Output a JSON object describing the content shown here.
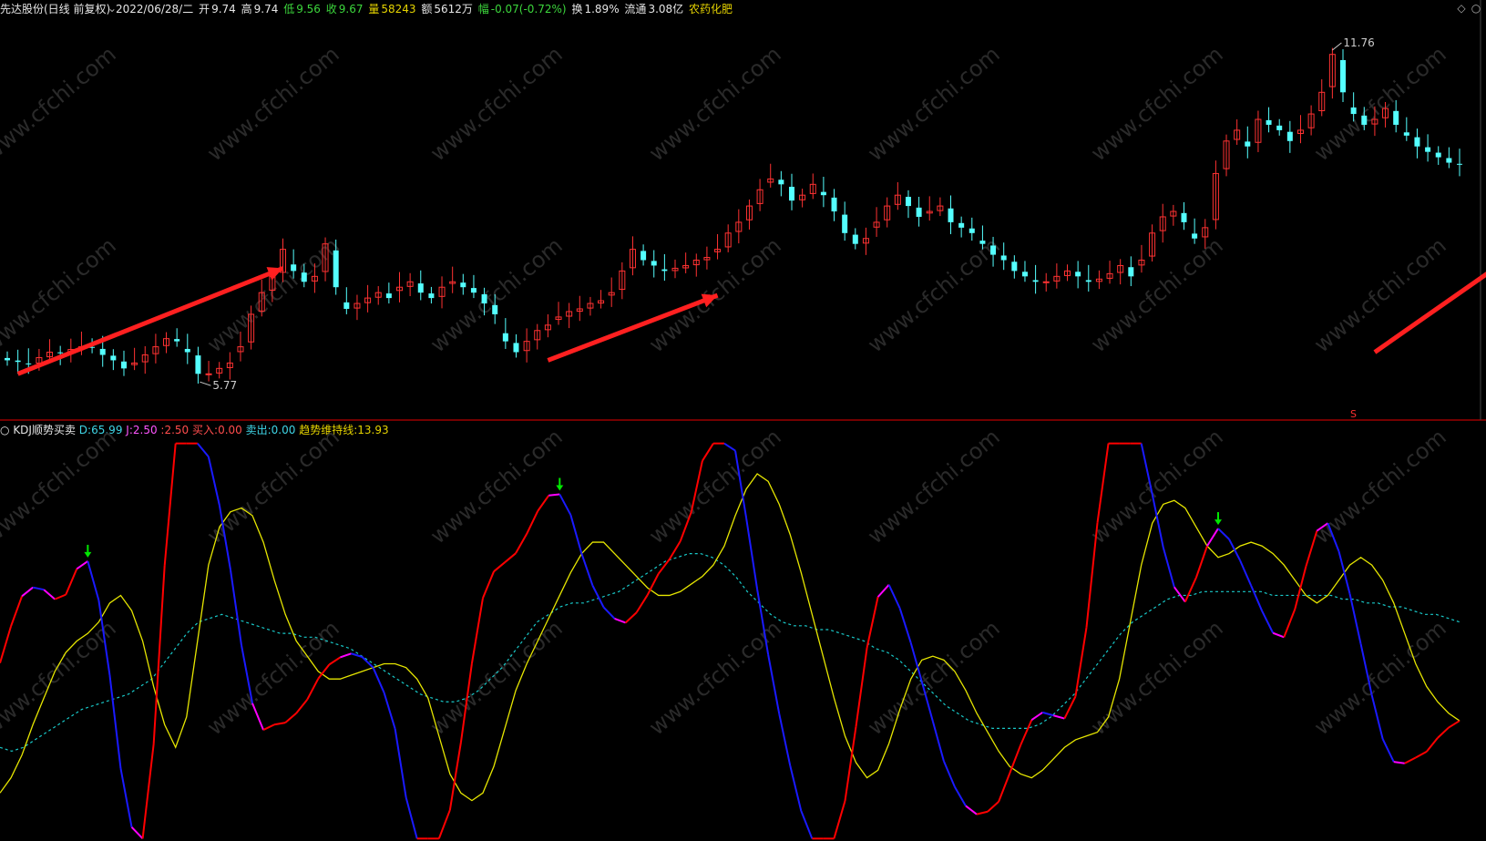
{
  "header": {
    "title": "先达股份(日线 前复权)",
    "date": "2022/06/28/二",
    "open_label": "开",
    "open": "9.74",
    "high_label": "高",
    "high": "9.74",
    "low_label": "低",
    "low": "9.56",
    "close_label": "收",
    "close": "9.67",
    "vol_label": "量",
    "vol": "58243",
    "amount_label": "额",
    "amount": "5612万",
    "change_label": "幅",
    "change": "-0.07(-0.72%)",
    "turnover_label": "换",
    "turnover": "1.89%",
    "float_label": "流通",
    "float": "3.08亿",
    "sector": "农药化肥",
    "icons": [
      "chevron-down-icon",
      "diamond-icon",
      "circle-icon"
    ]
  },
  "indicator": {
    "name": "KDJ顺势买卖",
    "d_label": "D:",
    "d_value": "65.99",
    "j_label": "J:",
    "j_value": "2.50",
    "k_value": "2.50",
    "buy_label": "买入:",
    "buy_value": "0.00",
    "sell_label": "卖出:",
    "sell_value": "0.00",
    "trend_label": "趋势维持线:",
    "trend_value": "13.93"
  },
  "annotations": {
    "high_price": "11.76",
    "low_price": "5.77",
    "s_marker": "S"
  },
  "watermark": "www.cfchi.com",
  "colors": {
    "up": "#ff3232",
    "down": "#54ffff",
    "arrow": "#ff2020",
    "k_up": "#ff0000",
    "k_down": "#1a1aff",
    "k_turn": "#ff00ff",
    "d_line": "#e6e600",
    "trend_line": "#19c8c8",
    "sell_arrow": "#00e600",
    "buy_arrow": "#ff2020",
    "divider": "#9b0000"
  },
  "chart_data": [
    {
      "type": "candlestick",
      "title": "先达股份(日线 前复权)",
      "ylim": [
        5.3,
        12.2
      ],
      "labels": [
        "11.76",
        "5.77"
      ],
      "close_path": [
        6.05,
        6.02,
        5.98,
        6.1,
        6.2,
        6.18,
        6.25,
        6.3,
        6.28,
        6.15,
        6.05,
        5.9,
        6.0,
        6.15,
        6.3,
        6.45,
        6.4,
        6.2,
        5.8,
        5.8,
        5.9,
        6.0,
        6.3,
        6.9,
        7.3,
        7.6,
        8.1,
        7.7,
        7.5,
        7.6,
        8.2,
        7.4,
        7.0,
        7.1,
        7.2,
        7.3,
        7.2,
        7.4,
        7.5,
        7.3,
        7.2,
        7.4,
        7.5,
        7.4,
        7.3,
        7.1,
        6.9,
        6.4,
        6.2,
        6.4,
        6.6,
        6.7,
        6.85,
        6.95,
        7.0,
        7.1,
        7.15,
        7.3,
        7.7,
        8.1,
        7.9,
        7.8,
        7.7,
        7.75,
        7.8,
        7.9,
        7.95,
        8.1,
        8.4,
        8.6,
        8.9,
        9.2,
        9.4,
        9.3,
        9.0,
        9.1,
        9.3,
        9.1,
        8.8,
        8.4,
        8.2,
        8.3,
        8.6,
        8.9,
        9.1,
        8.9,
        8.7,
        8.8,
        8.9,
        8.6,
        8.5,
        8.4,
        8.2,
        8.0,
        7.9,
        7.7,
        7.6,
        7.5,
        7.5,
        7.6,
        7.7,
        7.6,
        7.5,
        7.55,
        7.65,
        7.8,
        7.6,
        7.9,
        8.4,
        8.7,
        8.8,
        8.6,
        8.3,
        8.5,
        9.5,
        10.1,
        10.3,
        10.0,
        10.5,
        10.4,
        10.3,
        10.1,
        10.3,
        10.6,
        11.0,
        11.7,
        11.0,
        10.6,
        10.4,
        10.5,
        10.7,
        10.4,
        10.2,
        10.0,
        9.9,
        9.8,
        9.7,
        9.67
      ],
      "colors": {
        "up": "#ff3232",
        "down": "#54ffff"
      }
    },
    {
      "type": "line",
      "title": "KDJ顺势买卖",
      "ylim": [
        0,
        100
      ],
      "series": [
        {
          "name": "D",
          "color": "#e6e600",
          "values": [
            10,
            14,
            20,
            28,
            35,
            42,
            47,
            50,
            52,
            55,
            60,
            62,
            58,
            50,
            38,
            28,
            22,
            30,
            50,
            70,
            80,
            84,
            85,
            83,
            76,
            66,
            57,
            50,
            46,
            42,
            40,
            40,
            41,
            42,
            43,
            44,
            44,
            43,
            40,
            35,
            25,
            15,
            10,
            8,
            10,
            17,
            27,
            37,
            44,
            50,
            56,
            62,
            68,
            73,
            76,
            76,
            73,
            70,
            67,
            64,
            62,
            62,
            63,
            65,
            67,
            70,
            75,
            83,
            90,
            94,
            92,
            86,
            78,
            68,
            57,
            46,
            35,
            25,
            18,
            14,
            16,
            23,
            32,
            40,
            45,
            46,
            45,
            42,
            37,
            31,
            26,
            21,
            17,
            15,
            14,
            16,
            19,
            22,
            24,
            25,
            26,
            30,
            40,
            55,
            70,
            81,
            86,
            87,
            85,
            80,
            75,
            72,
            73,
            75,
            76,
            75,
            73,
            70,
            66,
            62,
            60,
            62,
            66,
            70,
            72,
            70,
            66,
            60,
            52,
            44,
            38,
            34,
            31,
            29
          ]
        },
        {
          "name": "趋势维持线",
          "color": "#19c8c8",
          "values": [
            22,
            21,
            22,
            24,
            26,
            28,
            30,
            32,
            33,
            34,
            35,
            36,
            38,
            40,
            44,
            48,
            52,
            55,
            56,
            57,
            56,
            55,
            54,
            53,
            52,
            52,
            51,
            51,
            50,
            49,
            48,
            46,
            44,
            42,
            40,
            38,
            36,
            35,
            34,
            34,
            35,
            37,
            40,
            43,
            47,
            51,
            55,
            57,
            59,
            60,
            60,
            61,
            62,
            63,
            65,
            67,
            69,
            71,
            72,
            73,
            73,
            72,
            70,
            67,
            63,
            60,
            57,
            55,
            54,
            54,
            53,
            53,
            52,
            51,
            50,
            48,
            47,
            45,
            42,
            39,
            36,
            33,
            31,
            29,
            28,
            27,
            27,
            27,
            27,
            28,
            30,
            33,
            36,
            40,
            44,
            48,
            52,
            55,
            57,
            59,
            61,
            62,
            62,
            63,
            63,
            63,
            63,
            63,
            63,
            62,
            62,
            62,
            62,
            62,
            62,
            61,
            61,
            60,
            60,
            59,
            59,
            58,
            57,
            57,
            56,
            55
          ]
        }
      ],
      "trend_value": 13.93
    }
  ]
}
